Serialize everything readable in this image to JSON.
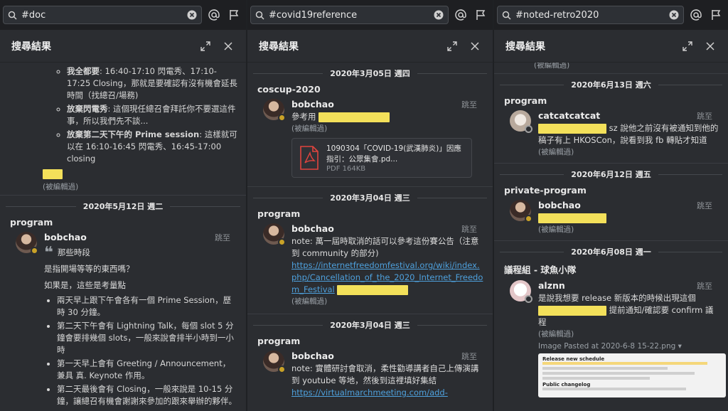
{
  "columns": [
    {
      "search": "#doc",
      "panel_title": "搜尋結果",
      "jump": "跳至",
      "edited": "(被編輯過)",
      "intro_bullets": [
        {
          "bold": "我全都要",
          "text": ": 16:40-17:10 閃電秀、17:10-17:25 Closing，那就是要確認有沒有機會延長時間（找總召/場務)"
        },
        {
          "bold": "放棄閃電秀",
          "text": ": 這個現任總召會拜託你不要選這件事，所以我們先不談..."
        },
        {
          "bold": "放棄第二天下午的 Prime session",
          "text": ": 這樣就可以在 16:10-16:45 閃電秀、16:45-17:00 closing"
        }
      ],
      "date1": "2020年5月12日 週二",
      "channel1": "program",
      "user1": "bobchao",
      "quote": "那些時段",
      "line1": "是指開場等等的東西嗎？",
      "line2": "如果是，這些是考量點",
      "bullets": [
        "兩天早上跟下午會各有一個 Prime Session，歷時 30 分鐘。",
        "第二天下午會有 Lightning Talk，每個 slot 5 分鐘會要排幾個 slots，一般來說會排半小時到一小時",
        "第一天早上會有 Greeting / Announcement，兼具 真. Keynote 作用。",
        "第二天最後會有 Closing，一般來說是 10-15 分鐘，讓總召有機會謝謝來參加的跟來舉辦的夥伴。"
      ]
    },
    {
      "search": "#covid19reference",
      "panel_title": "搜尋結果",
      "jump": "跳至",
      "edited": "(被編輯過)",
      "date1": "2020年3月05日 週四",
      "channel1": "coscup-2020",
      "user1": "bobchao",
      "msg1": "參考用",
      "file_name": "1090304「COVID-19(武漢肺炎)」因應指引：公眾集會.pd...",
      "file_meta": "PDF 164KB",
      "date2": "2020年3月04日 週三",
      "channel2": "program",
      "user2": "bobchao",
      "msg2": "note: 萬一屆時取消的話可以參考這份賽公告（注意到 community 的部分)",
      "link2": "https://internetfreedomfestival.org/wiki/index.php/Cancellation_of_the_2020_Internet_Freedom_Festival",
      "date3": "2020年3月04日 週三",
      "channel3": "program",
      "user3": "bobchao",
      "msg3": "note: 實體研討會取消，柔性勸導講者自己上傳演講到 youtube 等地，然後到這裡填好集結",
      "link3": "https://virtualmarchmeeting.com/add-"
    },
    {
      "search": "#noted-retro2020",
      "panel_title": "搜尋結果",
      "jump": "跳至",
      "edited": "(被編輯過)",
      "date1": "2020年6月13日 週六",
      "channel1": "program",
      "user1": "catcatcatcat",
      "msg1": "sz 說他之前沒有被通知到他的稿子有上 HKOSCon，說看到我 fb 轉貼才知道",
      "date2": "2020年6月12日 週五",
      "channel2": "private-program",
      "user2": "bobchao",
      "date3": "2020年6月08日 週一",
      "channel3": "議程組 - 球魚小隊",
      "user3": "alznn",
      "msg3a": "是說我想要 release 新版本的時候出現這個",
      "msg3b": "提前通知/確認要 confirm 議程",
      "image_caption": "Image Pasted at 2020-6-8 15-22.png",
      "thumb_title": "Release new schedule",
      "thumb_sub": "Public changelog"
    }
  ],
  "colors": {
    "highlight": "#f3e05a",
    "link": "#4ea0dc",
    "background": "#2b2d31"
  }
}
